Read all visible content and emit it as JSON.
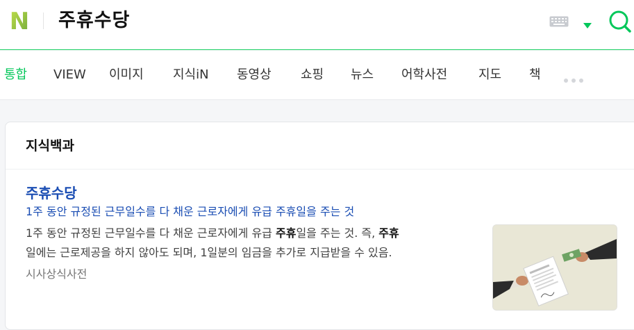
{
  "header": {
    "logo_text": "N",
    "query": "주휴수당",
    "keyboard_icon": "keyboard-icon",
    "dropdown_icon": "caret-down-icon",
    "search_icon": "search-icon",
    "brand_color": "#03c75a"
  },
  "tabs": [
    {
      "label": "통합",
      "active": true
    },
    {
      "label": "VIEW"
    },
    {
      "label": "이미지"
    },
    {
      "label": "지식iN"
    },
    {
      "label": "동영상"
    },
    {
      "label": "쇼핑"
    },
    {
      "label": "뉴스"
    },
    {
      "label": "어학사전"
    },
    {
      "label": "지도"
    },
    {
      "label": "책"
    }
  ],
  "more_icon": "more-dots-icon",
  "section": {
    "title": "지식백과",
    "result": {
      "title": "주휴수당",
      "subtitle": "1주 동안 규정된 근무일수를 다 채운 근로자에게 유급 주휴일을 주는 것",
      "desc_part1": "1주 동안 규정된 근무일수를 다 채운 근로자에게 유급 ",
      "desc_bold1": "주휴",
      "desc_part2": "일을 주는 것. 즉, ",
      "desc_bold2": "주휴",
      "desc_part3": "일에는 근로제공을 하지 않아도 되며, 1일분의 임금을 추가로 지급받을 수 있음.",
      "source": "시사상식사전"
    }
  }
}
